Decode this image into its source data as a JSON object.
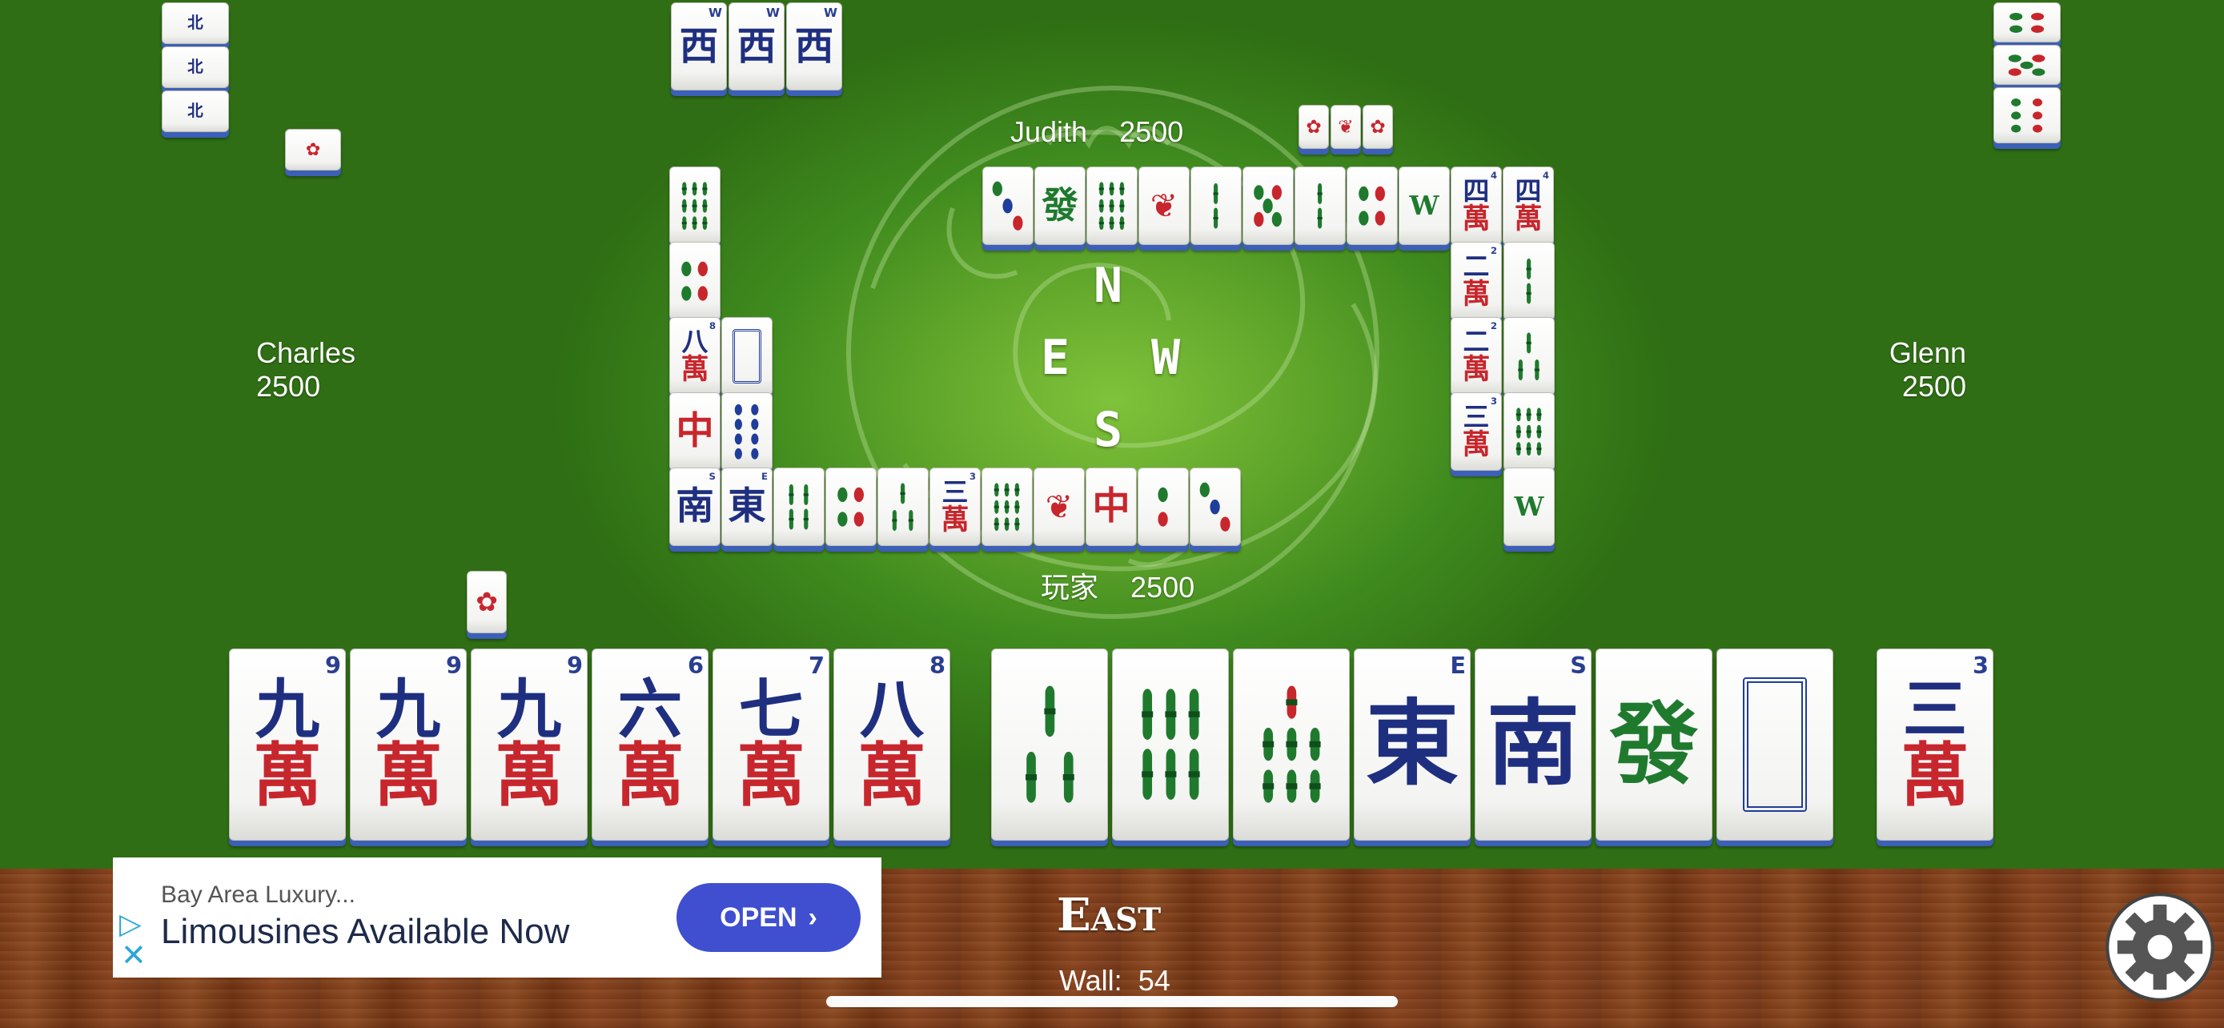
{
  "players": {
    "north": {
      "name": "Judith",
      "score": "2500"
    },
    "west": {
      "name": "Charles",
      "score": "2500"
    },
    "east": {
      "name": "Glenn",
      "score": "2500"
    },
    "south": {
      "name": "玩家",
      "score": "2500"
    }
  },
  "compass": {
    "n": "N",
    "e": "E",
    "w": "W",
    "s": "S"
  },
  "round_wind": "East",
  "wall": {
    "label": "Wall:",
    "count": "54"
  },
  "ad": {
    "subtitle": "Bay Area Luxury...",
    "title": "Limousines Available Now",
    "button": "OPEN"
  },
  "hand": {
    "tiles": [
      {
        "type": "character",
        "numeral": "九",
        "corner": "9"
      },
      {
        "type": "character",
        "numeral": "九",
        "corner": "9"
      },
      {
        "type": "character",
        "numeral": "九",
        "corner": "9"
      },
      {
        "type": "character",
        "numeral": "六",
        "corner": "6"
      },
      {
        "type": "character",
        "numeral": "七",
        "corner": "7"
      },
      {
        "type": "character",
        "numeral": "八",
        "corner": "8"
      },
      {
        "type": "bamboo",
        "value": 3
      },
      {
        "type": "bamboo",
        "value": 6
      },
      {
        "type": "bamboo",
        "value": 7
      },
      {
        "type": "wind",
        "glyph": "東",
        "corner": "E"
      },
      {
        "type": "wind",
        "glyph": "南",
        "corner": "S"
      },
      {
        "type": "dragon",
        "glyph": "發"
      },
      {
        "type": "white-dragon"
      }
    ],
    "drawn": {
      "type": "character",
      "numeral": "三",
      "corner": "3"
    }
  },
  "colors": {
    "felt": "#3f8a1e",
    "tile_back": "#3c5fb7",
    "character_red": "#c8262d",
    "numeral_blue": "#1f2f80",
    "green": "#1f7a2e"
  }
}
